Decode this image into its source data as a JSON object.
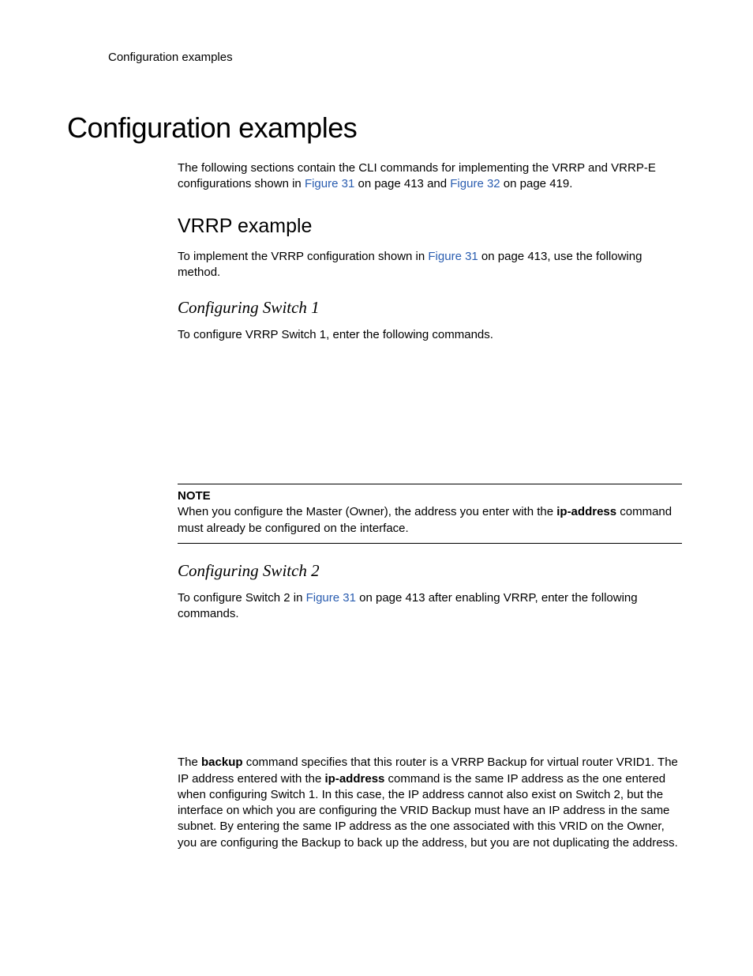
{
  "header": {
    "running": "Configuration examples"
  },
  "h1": "Configuration examples",
  "intro": {
    "t1": "The following sections contain the CLI commands for implementing the VRRP and VRRP-E configurations shown in ",
    "link1": "Figure 31",
    "t2": " on page 413 and ",
    "link2": "Figure 32",
    "t3": " on page 419."
  },
  "vrrp": {
    "heading": "VRRP example",
    "intro_t1": "To implement the VRRP configuration shown in ",
    "intro_link": "Figure 31",
    "intro_t2": " on page 413, use the following method."
  },
  "sw1": {
    "heading": "Configuring Switch 1",
    "text": "To configure VRRP Switch 1, enter the following commands."
  },
  "note": {
    "label": "NOTE",
    "t1": "When you configure the Master (Owner), the address you enter with the ",
    "bold": "ip-address",
    "t2": " command must already be configured on the interface."
  },
  "sw2": {
    "heading": "Configuring Switch 2",
    "intro_t1": "To configure Switch 2 in ",
    "intro_link": "Figure 31",
    "intro_t2": " on page 413 after enabling VRRP, enter the following commands."
  },
  "backup": {
    "t1": "The ",
    "b1": "backup",
    "t2": " command specifies that this router is a VRRP Backup for virtual router VRID1.  The IP address entered with the ",
    "b2": "ip-address",
    "t3": " command is the same IP address as the one entered when configuring Switch 1.  In this case, the IP address cannot also exist on Switch 2, but the interface on which you are configuring the VRID Backup must have an IP address in the same subnet.  By entering the same IP address as the one associated with this VRID on the Owner, you are configuring the Backup to back up the address, but you are not duplicating the address."
  }
}
